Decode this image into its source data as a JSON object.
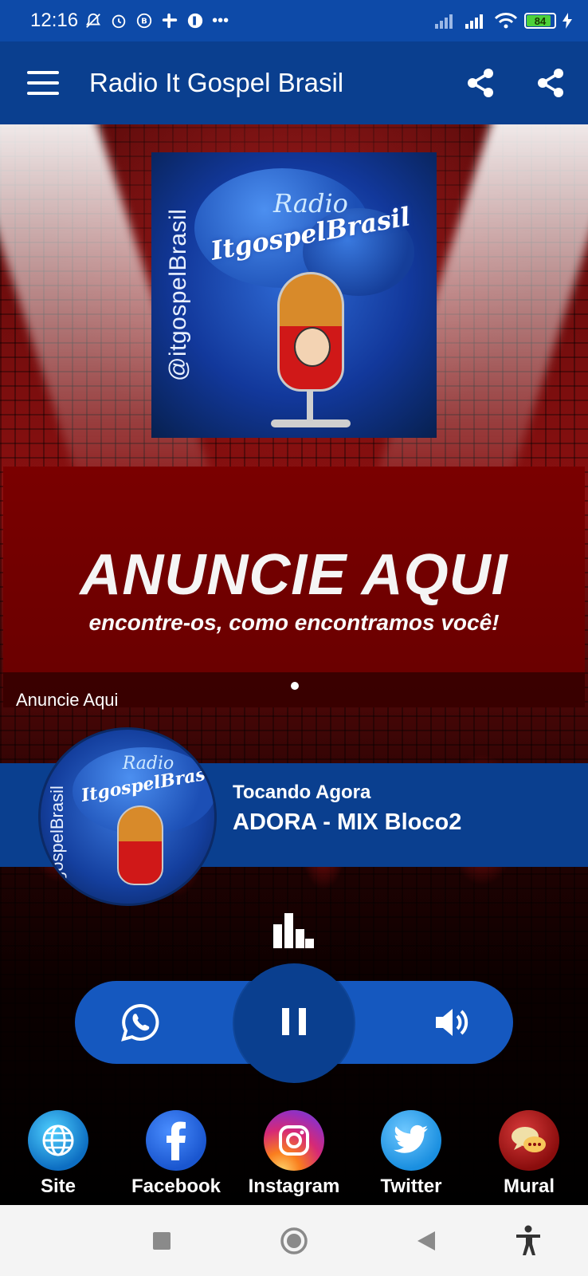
{
  "status_bar": {
    "time": "12:16",
    "extra_icons": "•••",
    "battery": "84"
  },
  "app_bar": {
    "title": "Radio It Gospel Brasil"
  },
  "cover": {
    "handle": "@itgospelBrasil",
    "brand_top": "Radio",
    "brand_main": "ItgospelBrasil"
  },
  "banner": {
    "title": "ANUNCIE AQUI",
    "subtitle": "encontre-os, como encontramos você!",
    "caption": "Anuncie Aqui"
  },
  "now_playing": {
    "label": "Tocando Agora",
    "track": "ADORA - MIX Bloco2",
    "avatar_handle": "gospelBrasil"
  },
  "social": [
    {
      "label": "Site",
      "icon": "globe-icon"
    },
    {
      "label": "Facebook",
      "icon": "facebook-icon"
    },
    {
      "label": "Instagram",
      "icon": "instagram-icon"
    },
    {
      "label": "Twitter",
      "icon": "twitter-icon"
    },
    {
      "label": "Mural",
      "icon": "chat-icon"
    }
  ],
  "colors": {
    "status_bar": "#0d4aa8",
    "app_bar": "#0a3f8f",
    "controls": "#1558bf",
    "banner": "#7a0000"
  }
}
